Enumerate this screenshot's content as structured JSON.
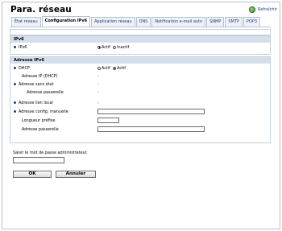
{
  "title": "Para. réseau",
  "refresh_label": "Rafraîchir",
  "tabs": [
    {
      "label": "État réseau",
      "active": false
    },
    {
      "label": "Configuration IPv6",
      "active": true
    },
    {
      "label": "Application réseau",
      "active": false
    },
    {
      "label": "DNS",
      "active": false
    },
    {
      "label": "Notification e-mail auto",
      "active": false
    },
    {
      "label": "SNMP",
      "active": false
    },
    {
      "label": "SMTP",
      "active": false
    },
    {
      "label": "POP3",
      "active": false
    }
  ],
  "ipv6_section": {
    "heading": "IPv6",
    "ipv6_label": "IPv6",
    "option_active": "Actif",
    "option_inactive": "Inactif",
    "selected": "Actif"
  },
  "address_section": {
    "heading": "Adresse IPv6",
    "dhcp_label": "DHCP",
    "dhcp_option_inactive": "Actif",
    "dhcp_option_active": "Actif",
    "dhcp_selected": "second",
    "dhcp_addr_label": "Adresse IP (DHCP)",
    "dhcp_addr_value": ":",
    "stateless_label": "Adresse sans état",
    "stateless_value": ":",
    "gateway_label": "Adresse passerelle",
    "gateway_value": ":",
    "link_local_label": "Adresse lien local",
    "link_local_value": ":",
    "manual_label": "Adresse config. manuelle",
    "manual_value": "",
    "prefix_label": "Longueur préfixe",
    "prefix_value": "",
    "manual_gateway_label": "Adresse passerelle",
    "manual_gateway_value": ""
  },
  "password": {
    "label": "Saisir le mot de passe administrateur.",
    "value": ""
  },
  "buttons": {
    "ok": "OK",
    "cancel": "Annuler"
  }
}
